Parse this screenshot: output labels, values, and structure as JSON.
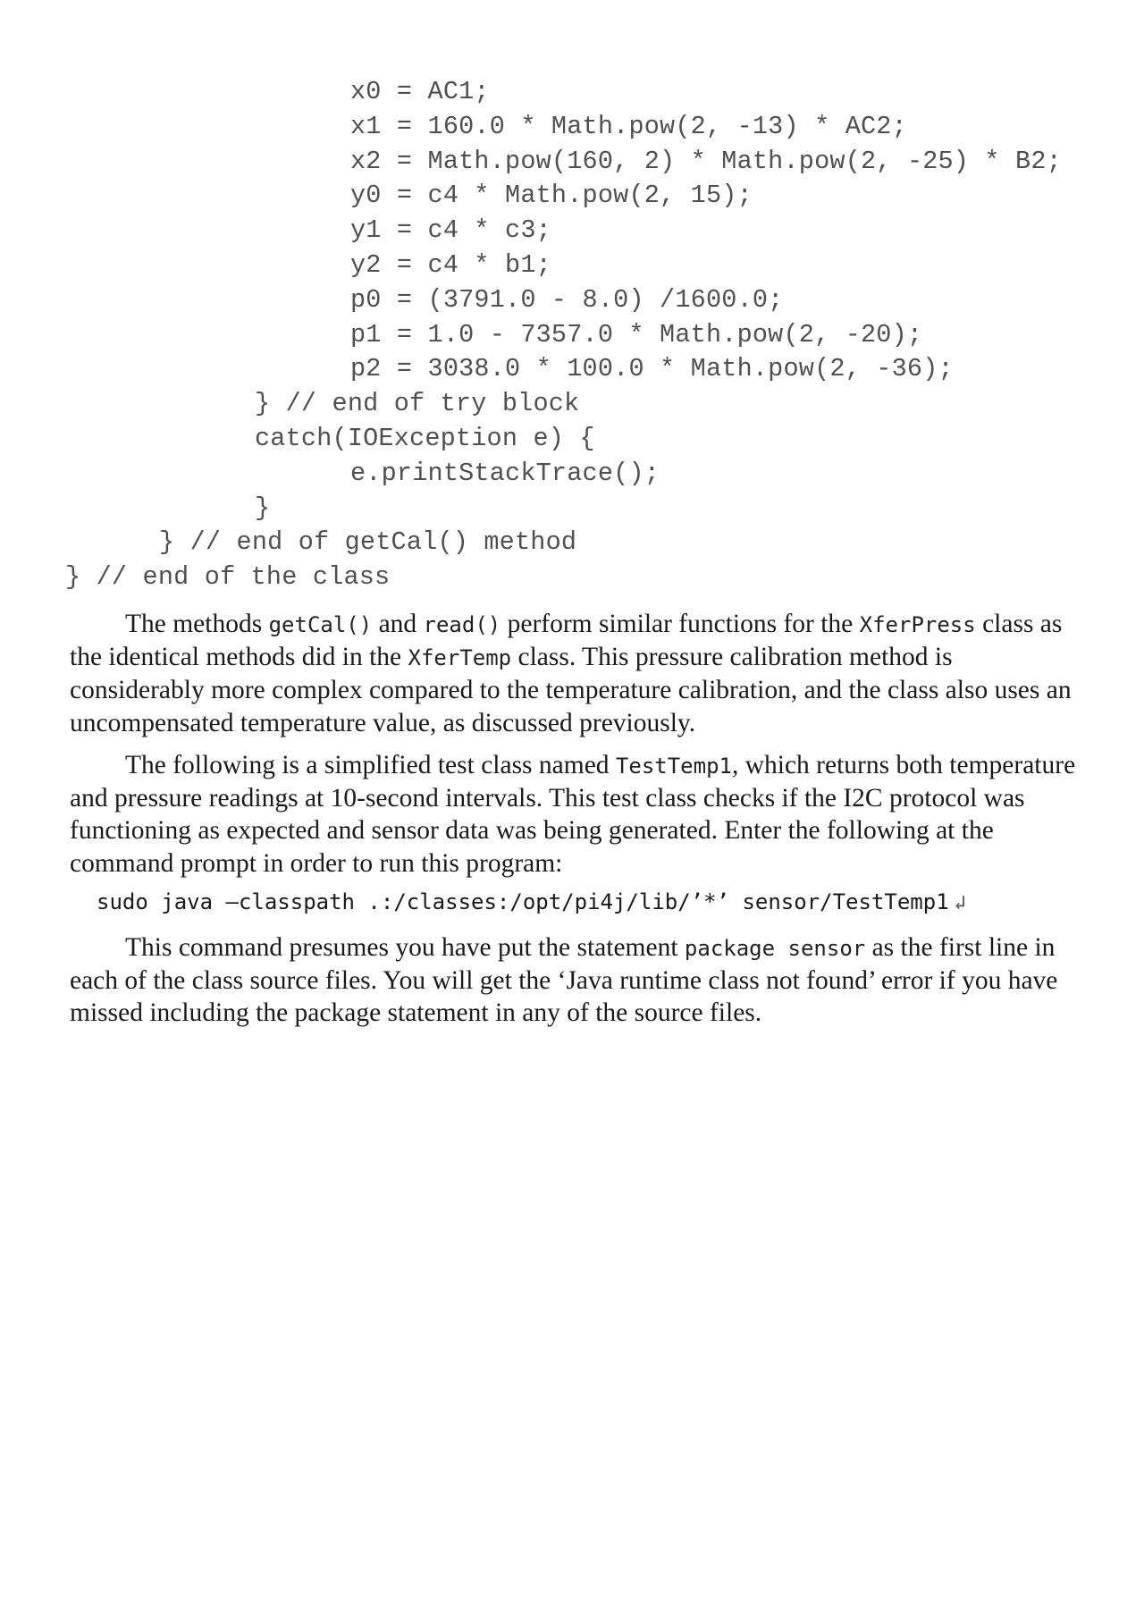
{
  "code_listing": {
    "lines": [
      {
        "indent": 4,
        "text": "x0 = AC1;"
      },
      {
        "indent": 4,
        "text": "x1 = 160.0 * Math.pow(2, -13) * AC2;"
      },
      {
        "indent": 4,
        "text": "x2 = Math.pow(160, 2) * Math.pow(2, -25) * B2;"
      },
      {
        "indent": 4,
        "text": "y0 = c4 * Math.pow(2, 15);"
      },
      {
        "indent": 4,
        "text": "y1 = c4 * c3;"
      },
      {
        "indent": 4,
        "text": "y2 = c4 * b1;"
      },
      {
        "indent": 4,
        "text": "p0 = (3791.0 - 8.0) /1600.0;"
      },
      {
        "indent": 4,
        "text": "p1 = 1.0 - 7357.0 * Math.pow(2, -20);"
      },
      {
        "indent": 4,
        "text": "p2 = 3038.0 * 100.0 * Math.pow(2, -36);"
      },
      {
        "indent": 2,
        "text": "} // end of try block"
      },
      {
        "indent": 2,
        "text": "catch(IOException e) {"
      },
      {
        "indent": 3,
        "text": "e.printStackTrace();"
      },
      {
        "indent": 2,
        "text": "}"
      },
      {
        "indent": 1,
        "text": "} // end of getCal() method"
      },
      {
        "indent": 0,
        "text": "} // end of the class"
      }
    ]
  },
  "paragraphs": [
    {
      "segments": [
        {
          "type": "text",
          "value": "The methods "
        },
        {
          "type": "code",
          "value": "getCal()"
        },
        {
          "type": "text",
          "value": " and "
        },
        {
          "type": "code",
          "value": "read()"
        },
        {
          "type": "text",
          "value": " perform similar functions for the "
        },
        {
          "type": "code",
          "value": "XferPress"
        },
        {
          "type": "text",
          "value": " class as the identical methods did in the "
        },
        {
          "type": "code",
          "value": "XferTemp"
        },
        {
          "type": "text",
          "value": " class. This pressure calibration method is considerably more complex compared to the temperature calibration, and the class also uses an uncompensated temperature value, as discussed previously."
        }
      ]
    },
    {
      "segments": [
        {
          "type": "text",
          "value": "The following is a simplified test class named "
        },
        {
          "type": "code",
          "value": "TestTemp1"
        },
        {
          "type": "text",
          "value": ", which returns both temperature and pressure readings at 10-second intervals. This test class checks if the I2C protocol was functioning as expected and sensor data was being generated. Enter the following at the command prompt in order to run this program:"
        }
      ]
    },
    {
      "segments": [
        {
          "type": "text",
          "value": "This command presumes you have put the statement "
        },
        {
          "type": "code",
          "value": "package sensor"
        },
        {
          "type": "text",
          "value": " as the first line in each of the class source files. You will get the ‘Java runtime class not found’ error if you have missed including the package statement in any of the source files."
        }
      ]
    }
  ],
  "command": {
    "text": "sudo java –classpath .:/classes:/opt/pi4j/lib/’*’ sensor/TestTemp1",
    "return_icon": "↲"
  }
}
